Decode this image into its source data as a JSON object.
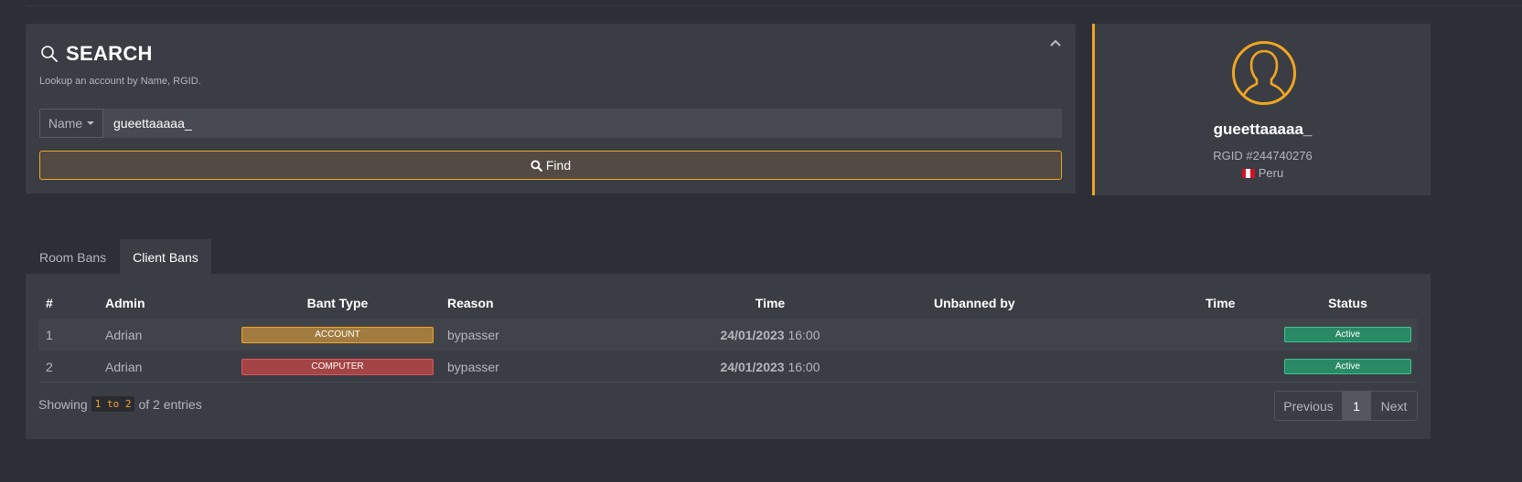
{
  "search": {
    "title": "SEARCH",
    "subtitle": "Lookup an account by Name, RGID.",
    "field_type": "Name",
    "query": "gueettaaaaa_",
    "find_label": "Find",
    "accent_color": "#f0a620"
  },
  "profile": {
    "name": "gueettaaaaa_",
    "rgid": "RGID #244740276",
    "country": "Peru"
  },
  "tabs": [
    {
      "label": "Room Bans",
      "active": false
    },
    {
      "label": "Client Bans",
      "active": true
    }
  ],
  "table": {
    "columns": [
      "#",
      "Admin",
      "Bant Type",
      "Reason",
      "Time",
      "Unbanned by",
      "Time",
      "Status"
    ],
    "rows": [
      {
        "num": "1",
        "admin": "Adrian",
        "type": "ACCOUNT",
        "reason": "bypasser",
        "date": "24/01/2023",
        "hour": "16:00",
        "unbanned_by": "",
        "unban_time": "",
        "status": "Active"
      },
      {
        "num": "2",
        "admin": "Adrian",
        "type": "COMPUTER",
        "reason": "bypasser",
        "date": "24/01/2023",
        "hour": "16:00",
        "unbanned_by": "",
        "unban_time": "",
        "status": "Active"
      }
    ]
  },
  "footer": {
    "showing_prefix": "Showing",
    "range": "1 to 2",
    "showing_suffix": "of 2 entries"
  },
  "pagination": {
    "previous": "Previous",
    "current": "1",
    "next": "Next"
  }
}
